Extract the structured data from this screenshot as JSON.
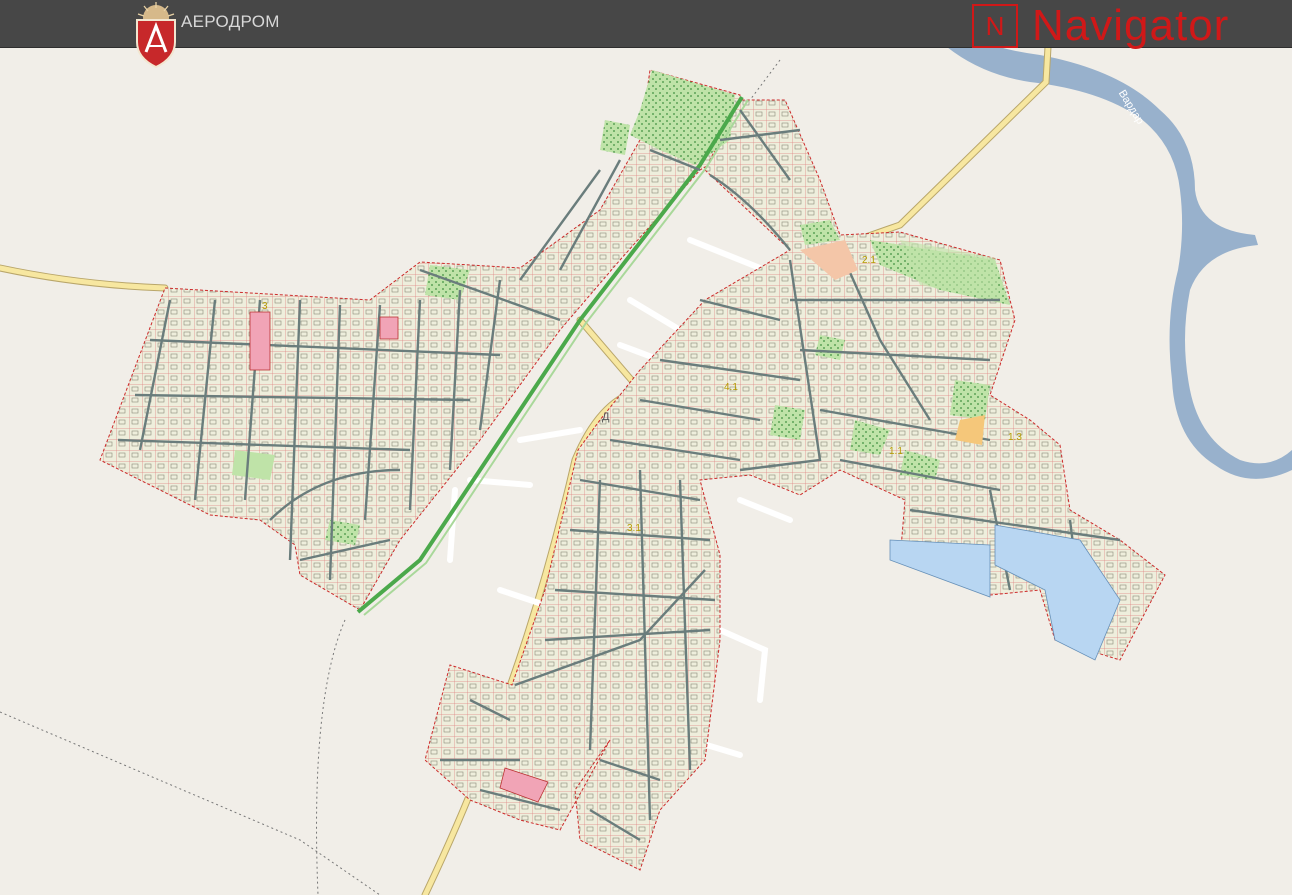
{
  "header": {
    "municipality": "АЕРОДРОМ",
    "brand_box_letter": "N",
    "brand_name": "Navigator",
    "brand_color": "#d01818"
  },
  "map": {
    "river_label": "Вардар",
    "street_label": "Д",
    "district_markers": [
      "3",
      "4.1",
      "3.1",
      "2.1",
      "1.1",
      "1.3"
    ],
    "colors": {
      "land": "#f1eee8",
      "water": "#98b1cc",
      "main_road": "#f7e7a0",
      "parcel_fill": "#eeeedc",
      "street": "#6a7d7c",
      "park": "#bfe3a8",
      "boundary": "#cc2a2a",
      "public_zone": "#f1a4b6",
      "industrial_zone": "#b8d6f2"
    },
    "icons": [
      "emblem-icon",
      "navigator-logo-icon"
    ]
  }
}
